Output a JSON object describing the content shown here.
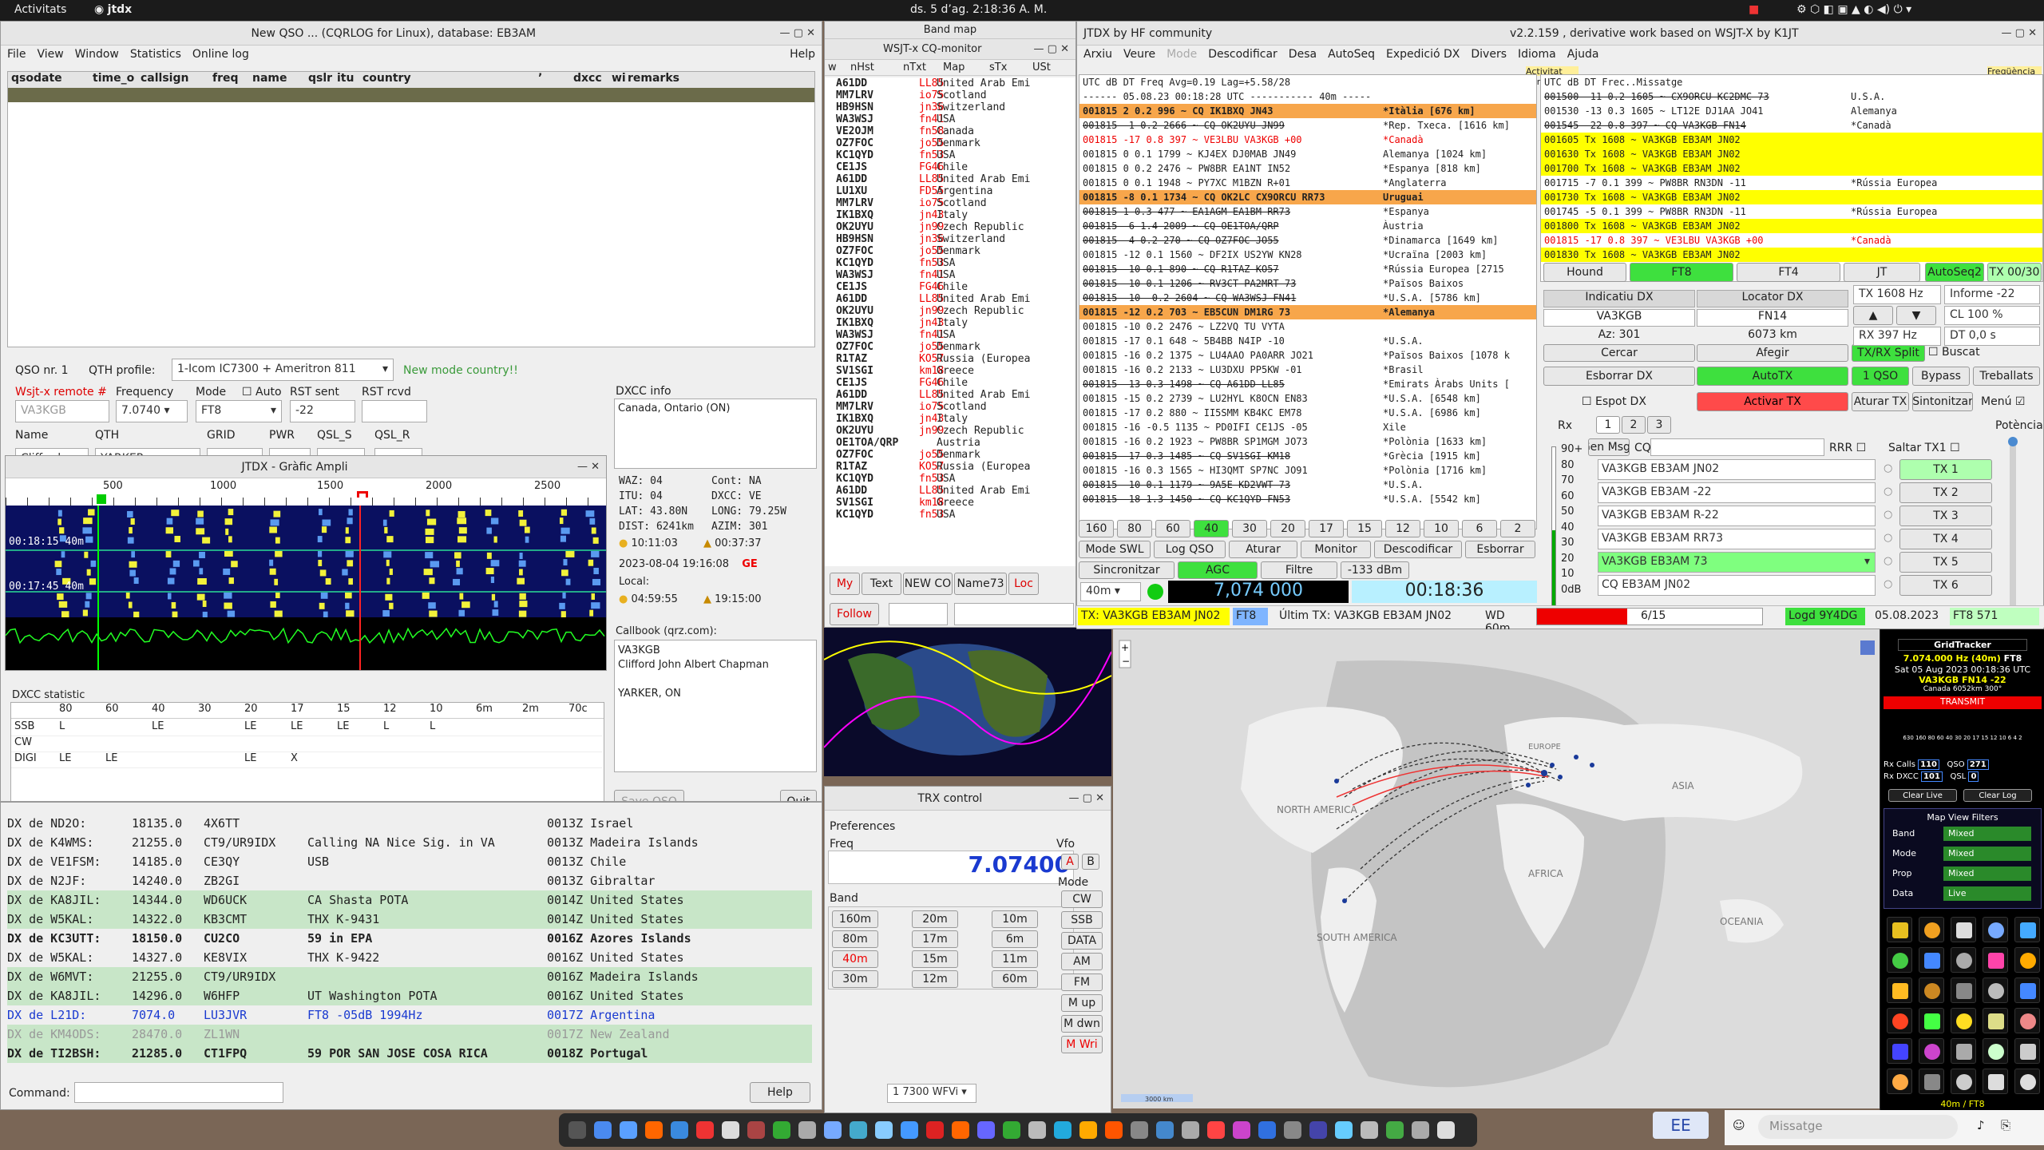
{
  "topbar": {
    "activities": "Activitats",
    "app": "jtdx",
    "clock": "ds. 5 d’ag.  2:18:36 A. M."
  },
  "cqrlog": {
    "title": "New QSO ... (CQRLOG for Linux), database: EB3AM",
    "menu": [
      "File",
      "View",
      "Window",
      "Statistics",
      "Online log"
    ],
    "help": "Help",
    "cols": [
      "qsodate",
      "time_o",
      "callsign",
      "freq",
      "name",
      "qslr",
      "itu",
      "country",
      "’",
      "dxcc",
      "wi",
      "remarks"
    ],
    "qso_nr": "QSO nr. 1",
    "qth_profile_label": "QTH profile:",
    "qth_profile": "1-Icom IC7300 + Ameritron 811",
    "new_mode": "New mode country!!",
    "remote": "Wsjt-x remote #",
    "frequency_label": "Frequency",
    "mode_label": "Mode",
    "auto_label": "Auto",
    "rst_sent_label": "RST sent",
    "rst_rcvd_label": "RST rcvd",
    "callsign": "VA3KGB",
    "frequency": "7.0740",
    "mode": "FT8",
    "rst_sent": "-22",
    "name_label": "Name",
    "qth_label": "QTH",
    "grid_label": "GRID",
    "pwr_label": "PWR",
    "qsl_s_label": "QSL_S",
    "qsl_r_label": "QSL_R",
    "name": "Clifford",
    "qth": "YARKER",
    "dxcc_info_label": "DXCC info",
    "dxcc_info": "Canada, Ontario (ON)",
    "waz": "WAZ: 04",
    "cont": "Cont:  NA",
    "itu": "ITU:  04",
    "dxcc": "DXCC: VE",
    "lat": "LAT:  43.80N",
    "long": "LONG: 79.25W",
    "dist": "DIST: 6241km",
    "azim": "AZIM: 301",
    "sunrise": "10:11:03",
    "sunset": "00:37:37",
    "date": "2023-08-04  19:16:08",
    "ge": "GE",
    "local_label": "Local:",
    "local_rise": "04:59:55",
    "local_set": "19:15:00",
    "callbook_label": "Callbook (qrz.com):",
    "callbook": [
      "VA3KGB",
      "Clifford John Albert Chapman",
      "",
      "YARKER, ON"
    ],
    "dxcc_stat_label": "DXCC statistic",
    "bands": [
      "80",
      "60",
      "40",
      "30",
      "20",
      "17",
      "15",
      "12",
      "10",
      "6m",
      "2m",
      "70c"
    ],
    "stat_rows": [
      {
        "mode": "SSB",
        "cells": [
          "L",
          "",
          "LE",
          "",
          "LE",
          "LE",
          "LE",
          "L",
          "L",
          "",
          "",
          ""
        ]
      },
      {
        "mode": "CW",
        "cells": [
          "",
          "",
          "",
          "",
          "",
          "",
          "",
          "",
          "",
          "",
          "",
          ""
        ]
      },
      {
        "mode": "DIGI",
        "cells": [
          "LE",
          "LE",
          "",
          "",
          "LE",
          "X",
          "",
          "",
          "",
          "",
          "",
          ""
        ]
      }
    ],
    "save": "Save QSO",
    "quit": "Quit"
  },
  "ampli": {
    "title": "JTDX - Gràfic Ampli",
    "scale": [
      "500",
      "1000",
      "1500",
      "2000",
      "2500"
    ],
    "t1": "00:18:15  40m",
    "t2": "00:17:45  40m"
  },
  "cluster": {
    "rows": [
      {
        "dx": "DX de ND2O:",
        "f": "18135.0",
        "call": "4X6TT",
        "c": "",
        "t": "0013Z Israel",
        "cls": ""
      },
      {
        "dx": "DX de K4WMS:",
        "f": "21255.0",
        "call": "CT9/UR9IDX",
        "c": "Calling NA Nice Sig. in VA",
        "t": "0013Z Madeira Islands",
        "cls": ""
      },
      {
        "dx": "DX de VE1FSM:",
        "f": "14185.0",
        "call": "CE3QY",
        "c": "USB",
        "t": "0013Z Chile",
        "cls": ""
      },
      {
        "dx": "DX de N2JF:",
        "f": "14240.0",
        "call": "ZB2GI",
        "c": "",
        "t": "0013Z Gibraltar",
        "cls": ""
      },
      {
        "dx": "DX de KA8JIL:",
        "f": "14344.0",
        "call": "WD6UCK",
        "c": "CA Shasta POTA",
        "t": "0014Z United States",
        "cls": "hl-g"
      },
      {
        "dx": "DX de W5KAL:",
        "f": "14322.0",
        "call": "KB3CMT",
        "c": "THX K-9431",
        "t": "0014Z United States",
        "cls": "hl-g"
      },
      {
        "dx": "DX de KC3UTT:",
        "f": "18150.0",
        "call": "CU2CO",
        "c": "59 in EPA",
        "t": "0016Z Azores Islands",
        "cls": "bold"
      },
      {
        "dx": "DX de W5KAL:",
        "f": "14327.0",
        "call": "KE8VIX",
        "c": "THX K-9422",
        "t": "0016Z United States",
        "cls": ""
      },
      {
        "dx": "DX de W6MVT:",
        "f": "21255.0",
        "call": "CT9/UR9IDX",
        "c": "",
        "t": "0016Z Madeira Islands",
        "cls": "hl-g"
      },
      {
        "dx": "DX de KA8JIL:",
        "f": "14296.0",
        "call": "W6HFP",
        "c": "UT Washington POTA",
        "t": "0016Z United States",
        "cls": "hl-g"
      },
      {
        "dx": "DX de L21D:",
        "f": "7074.0",
        "call": "LU3JVR",
        "c": "FT8 -05dB 1994Hz",
        "t": "0017Z Argentina",
        "cls": "blue"
      },
      {
        "dx": "DX de KM4ODS:",
        "f": "28470.0",
        "call": "ZL1WN",
        "c": "",
        "t": "0017Z New Zealand",
        "cls": "grey hl-g"
      },
      {
        "dx": "DX de TI2BSH:",
        "f": "21285.0",
        "call": "CT1FPQ",
        "c": "59 POR SAN JOSE COSA RICA",
        "t": "0018Z Portugal",
        "cls": "bold hl-g"
      }
    ],
    "command": "Command:",
    "help": "Help"
  },
  "cqmon": {
    "band_map": "Band map",
    "title": "WSJT-x CQ-monitor",
    "cols": [
      "w",
      "nHst",
      "nTxt",
      "Map",
      "sTx",
      "USt"
    ],
    "rows": [
      [
        "A61DD",
        "LL85",
        "United Arab Emi"
      ],
      [
        "MM7LRV",
        "io75",
        "Scotland"
      ],
      [
        "HB9HSN",
        "jn36",
        "Switzerland"
      ],
      [
        "WA3WSJ",
        "fn41",
        "USA"
      ],
      [
        "VE2OJM",
        "fn58",
        "Canada"
      ],
      [
        "OZ7FOC",
        "jo55",
        "Denmark"
      ],
      [
        "KC1QYD",
        "fn53",
        "USA"
      ],
      [
        "CE1JS",
        "FG46",
        "Chile"
      ],
      [
        "A61DD",
        "LL85",
        "United Arab Emi"
      ],
      [
        "LU1XU",
        "FD55",
        "Argentina"
      ],
      [
        "MM7LRV",
        "io75",
        "Scotland"
      ],
      [
        "IK1BXQ",
        "jn43",
        "Italy"
      ],
      [
        "OK2UYU",
        "jn99",
        "Czech Republic"
      ],
      [
        "HB9HSN",
        "jn36",
        "Switzerland"
      ],
      [
        "OZ7FOC",
        "jo55",
        "Denmark"
      ],
      [
        "KC1QYD",
        "fn53",
        "USA"
      ],
      [
        "WA3WSJ",
        "fn41",
        "USA"
      ],
      [
        "CE1JS",
        "FG46",
        "Chile"
      ],
      [
        "A61DD",
        "LL85",
        "United Arab Emi"
      ],
      [
        "OK2UYU",
        "jn99",
        "Czech Republic"
      ],
      [
        "IK1BXQ",
        "jn43",
        "Italy"
      ],
      [
        "WA3WSJ",
        "fn41",
        "USA"
      ],
      [
        "OZ7FOC",
        "jo55",
        "Denmark"
      ],
      [
        "R1TAZ",
        "KO57",
        "Russia (Europea"
      ],
      [
        "SV1SGI",
        "km18",
        "Greece"
      ],
      [
        "CE1JS",
        "FG46",
        "Chile"
      ],
      [
        "A61DD",
        "LL85",
        "United Arab Emi"
      ],
      [
        "MM7LRV",
        "io75",
        "Scotland"
      ],
      [
        "IK1BXQ",
        "jn43",
        "Italy"
      ],
      [
        "OK2UYU",
        "jn99",
        "Czech Republic"
      ],
      [
        "OE1TOA/QRP",
        "",
        "Austria"
      ],
      [
        "OZ7FOC",
        "jo55",
        "Denmark"
      ],
      [
        "R1TAZ",
        "KO57",
        "Russia (Europea"
      ],
      [
        "KC1QYD",
        "fn53",
        "USA"
      ],
      [
        "A61DD",
        "LL85",
        "United Arab Emi"
      ],
      [
        "SV1SGI",
        "km18",
        "Greece"
      ],
      [
        "KC1QYD",
        "fn53",
        "USA"
      ]
    ],
    "btns": [
      "My",
      "Text",
      "NEW CO",
      "Name73",
      "Loc"
    ],
    "follow": "Follow"
  },
  "trx": {
    "title": "TRX control",
    "prefs": "Preferences",
    "freq_label": "Freq",
    "freq": "7.07400",
    "band_label": "Band",
    "bands": [
      "160m",
      "20m",
      "10m",
      "80m",
      "17m",
      "6m",
      "40m",
      "15m",
      "11m",
      "30m",
      "12m",
      "60m"
    ],
    "vfo_label": "Vfo",
    "vfoa": "A",
    "vfob": "B",
    "mode_label": "Mode",
    "modes": [
      "CW",
      "SSB",
      "DATA",
      "AM",
      "FM",
      "M up",
      "M dwn",
      "M Wri"
    ],
    "wfvi": "1 7300 WFVi"
  },
  "jtdx": {
    "title": "JTDX  by HF community",
    "version": "v2.2.159 , derivative work based on WSJT-X by K1JT",
    "menu": [
      "Arxiu",
      "Veure",
      "Mode",
      "Descodificar",
      "Desa",
      "AutoSeq",
      "Expedició DX",
      "Divers",
      "Idioma",
      "Ajuda"
    ],
    "band_act": "Activitat banda",
    "rx_freq": "Freqüència RX",
    "lhead": "UTC     dB  DT Freq   Avg=0.19 Lag=+5.58/28",
    "lsep": "------ 05.08.23 00:18:28 UTC ----------- 40m -----",
    "left": [
      {
        "t": "001815   2  0.2  996 ~ CQ IK1BXQ JN43",
        "n": "*Itàlia [676 km]",
        "c": "hl-o"
      },
      {
        "t": "001815  -1  0.2 2666 ~ CQ OK2UYU JN99",
        "n": "*Rep. Txeca. [1616 km]",
        "c": "strike"
      },
      {
        "t": "001815 -17  0.8  397 ~ VE3LBU VA3KGB +00",
        "n": "*Canadà",
        "c": "red"
      },
      {
        "t": "001815   0  0.1 1799 ~ KJ4EX DJ0MAB JN49",
        "n": " Alemanya [1024 km]",
        "c": ""
      },
      {
        "t": "001815   0  0.2 2476 ~ PW8BR EA1NT IN52",
        "n": "*Espanya [818 km]",
        "c": ""
      },
      {
        "t": "001815   0  0.1 1948 ~ PY7XC M1BZN R+01",
        "n": "*Anglaterra",
        "c": ""
      },
      {
        "t": "001815  -8  0.1 1734 ~ CQ OK2LC CX9ORCU RR73",
        "n": " Uruguai",
        "c": "hl-o"
      },
      {
        "t": "001815   1  0.3  477 ~ EA1AGM EA1BM RR73",
        "n": "*Espanya",
        "c": "strike"
      },
      {
        "t": "001815  -6  1.4 2009 ~ CQ OE1TOA/QRP",
        "n": " Àustria",
        "c": "strike"
      },
      {
        "t": "001815  -4  0.2  270 ~ CQ OZ7FOC JO55",
        "n": "*Dinamarca [1649 km]",
        "c": "strike"
      },
      {
        "t": "001815 -12  0.1 1560 ~ DF2IX US2YW KN28",
        "n": "*Ucraïna [2003 km]",
        "c": ""
      },
      {
        "t": "001815 -10  0.1  890 ~ CQ R1TAZ KO57",
        "n": "*Rússia Europea [2715",
        "c": "strike"
      },
      {
        "t": "001815 -10  0.1 1206 ~ RV3CT PA2MRT 73",
        "n": "*Països Baixos",
        "c": "strike"
      },
      {
        "t": "001815 -10 -0.2 2604 ~ CQ WA3WSJ FN41",
        "n": "*U.S.A. [5786 km]",
        "c": "strike"
      },
      {
        "t": "001815 -12  0.2  703 ~ EB5CUN DM1RG 73",
        "n": "*Alemanya",
        "c": "hl-o"
      },
      {
        "t": "001815 -10  0.2 2476 ~ LZ2VQ TU VYTA",
        "n": "",
        "c": ""
      },
      {
        "t": "001815 -17  0.1  648 ~ 5B4BB N4IP -10",
        "n": "*U.S.A.",
        "c": ""
      },
      {
        "t": "001815 -16  0.2 1375 ~ LU4AAO PA0ARR JO21",
        "n": "*Països Baixos [1078 k",
        "c": ""
      },
      {
        "t": "001815 -16  0.2 2133 ~ LU3DXU PP5KW -01",
        "n": "*Brasil",
        "c": ""
      },
      {
        "t": "001815 -13  0.3 1498 ~ CQ A61DD LL85",
        "n": "*Emirats Àrabs Units [",
        "c": "strike"
      },
      {
        "t": "001815 -15  0.2 2739 ~ LU2HYL K8OCN EN83",
        "n": "*U.S.A. [6548 km]",
        "c": ""
      },
      {
        "t": "001815 -17  0.2  880 ~ II5SMM KB4KC EM78",
        "n": "*U.S.A. [6986 km]",
        "c": ""
      },
      {
        "t": "001815 -16 -0.5 1135 ~ PD0IFI CE1JS -05",
        "n": " Xile",
        "c": ""
      },
      {
        "t": "001815 -16  0.2 1923 ~ PW8BR SP1MGM JO73",
        "n": "*Polònia [1633 km]",
        "c": ""
      },
      {
        "t": "001815 -17  0.3 1485 ~ CQ SV1SGI KM18",
        "n": "*Grècia [1915 km]",
        "c": "strike"
      },
      {
        "t": "001815 -16  0.3 1565 ~ HI3QMT SP7NC JO91",
        "n": "*Polònia [1716 km]",
        "c": ""
      },
      {
        "t": "001815 -10  0.1 1179 ~ 9A5E KD2VWT 73",
        "n": "*U.S.A.",
        "c": "strike"
      },
      {
        "t": "001815 -18  1.3 1450 ~ CQ KC1QYD FN53",
        "n": "*U.S.A. [5542 km]",
        "c": "strike"
      }
    ],
    "rhead": "UTC     dB  DT Frec..Missatge",
    "right": [
      {
        "t": "001500 -11  0.2 1605 ~ CX9ORCU KC2DMC 73",
        "n": "U.S.A.",
        "c": "strike"
      },
      {
        "t": "001530 -13  0.3 1605 ~ LT12E DJ1AA JO41",
        "n": "Alemanya",
        "c": ""
      },
      {
        "t": "001545 -22  0.8  397 ~ CQ VA3KGB FN14",
        "n": "*Canadà",
        "c": "strike"
      },
      {
        "t": "001605  Tx      1608 ~ VA3KGB EB3AM JN02",
        "n": "",
        "c": "hl-y"
      },
      {
        "t": "001630  Tx      1608 ~ VA3KGB EB3AM JN02",
        "n": "",
        "c": "hl-y"
      },
      {
        "t": "001700  Tx      1608 ~ VA3KGB EB3AM JN02",
        "n": "",
        "c": "hl-y"
      },
      {
        "t": "001715  -7  0.1  399 ~ PW8BR RN3DN -11",
        "n": "*Rússia Europea",
        "c": ""
      },
      {
        "t": "001730  Tx      1608 ~ VA3KGB EB3AM JN02",
        "n": "",
        "c": "hl-y"
      },
      {
        "t": "001745  -5  0.1  399 ~ PW8BR RN3DN -11",
        "n": "*Rússia Europea",
        "c": ""
      },
      {
        "t": "001800  Tx      1608 ~ VA3KGB EB3AM JN02",
        "n": "",
        "c": "hl-y"
      },
      {
        "t": "001815 -17  0.8  397 ~ VE3LBU VA3KGB +00",
        "n": "*Canadà",
        "c": "red"
      },
      {
        "t": "001830  Tx      1608 ~ VA3KGB EB3AM JN02",
        "n": "",
        "c": "hl-y"
      }
    ],
    "bandbtns": [
      "160",
      "80",
      "60",
      "40",
      "30",
      "20",
      "17",
      "15",
      "12",
      "10",
      "6",
      "2"
    ],
    "row1": [
      "Mode SWL",
      "Log QSO",
      "Aturar",
      "Monitor",
      "Descodificar",
      "Esborrar"
    ],
    "row2": [
      "Sincronitzar",
      "AGC",
      "Filtre",
      "-133 dBm"
    ],
    "band": "40m",
    "freq": "7,074 000",
    "time": "00:18:36",
    "topbtns": [
      "Hound",
      "FT8",
      "FT4",
      "JT",
      "AutoSeq2",
      "TX 00/30"
    ],
    "ind_dx": "Indicatiu DX",
    "loc_dx": "Locator DX",
    "dx_call": "VA3KGB",
    "dx_loc": "FN14",
    "az": "Az: 301",
    "dist": "6073 km",
    "cercar": "Cercar",
    "afegir": "Afegir",
    "txrx": "TX/RX Split",
    "buscat": "Buscat",
    "esb_dx": "Esborrar DX",
    "autotx": "AutoTX",
    "oneqso": "1 QSO",
    "bypass": "Bypass",
    "treballats": "Treballats",
    "espot": "Espot DX",
    "activar": "Activar TX",
    "aturar_tx": "Aturar TX",
    "sintonitzar": "Sintonitzar",
    "menu_chk": "Menú",
    "tx_hz": "TX  1608  Hz",
    "rx_hz": "RX  397  Hz",
    "informe": "Informe -22",
    "cl": "CL  100 %",
    "dt": "DT 0,0 s",
    "rx": "Rx",
    "tabs": [
      "1",
      "2",
      "3"
    ],
    "gen": "Gen Msgs",
    "cq": "CQ",
    "rrr": "RRR",
    "saltar": "Saltar TX1",
    "potencia": "Potència",
    "msgs": [
      "VA3KGB EB3AM JN02",
      "VA3KGB EB3AM -22",
      "VA3KGB EB3AM R-22",
      "VA3KGB EB3AM RR73",
      "VA3KGB EB3AM 73",
      "CQ EB3AM JN02"
    ],
    "txb": [
      "TX 1",
      "TX 2",
      "TX 3",
      "TX 4",
      "TX 5",
      "TX 6"
    ],
    "meter": [
      "90+",
      "80",
      "70",
      "60",
      "50",
      "40",
      "30",
      "20",
      "10",
      "0dB"
    ],
    "status": {
      "tx": "TX: VA3KGB EB3AM JN02",
      "mode": "FT8",
      "last": "Últim TX: VA3KGB EB3AM JN02",
      "wd": "WD 60m",
      "count": "6/15",
      "logd": "Logd 9Y4DG",
      "date": "05.08.2023",
      "ft8": "FT8 571"
    }
  },
  "map": {
    "labels": [
      "NORTH AMERICA",
      "SOUTH AMERICA",
      "AFRICA",
      "ASIA",
      "OCEANIA",
      "EUROPE"
    ],
    "scale": "3000 km"
  },
  "grid": {
    "title": "GridTracker",
    "freq": "7.074.000 Hz (40m)",
    "mode": "FT8",
    "date": "Sat 05 Aug 2023 00:18:36 UTC",
    "call": "VA3KGB FN14 -22",
    "sub": "Canada   6052km 300°",
    "transmit": "TRANSMIT",
    "scale": "630 160 80 60 40 30 20 17 15 12 10 6 4 2",
    "rxcalls_label": "Rx Calls",
    "rxcalls": "110",
    "qso_label": "QSO",
    "qso": "271",
    "rxdxcc_label": "Rx DXCC",
    "rxdxcc": "101",
    "qsl_label": "QSL",
    "qsl": "0",
    "clear_live": "Clear Live",
    "clear_log": "Clear Log",
    "filters": "Map View Filters",
    "flt": [
      [
        "Band",
        "Mixed"
      ],
      [
        "Mode",
        "Mixed"
      ],
      [
        "Prop",
        "Mixed"
      ],
      [
        "Data",
        "Live"
      ]
    ],
    "foot": "40m / FT8"
  },
  "chat": {
    "avatar": "EE",
    "placeholder": "Missatge"
  }
}
